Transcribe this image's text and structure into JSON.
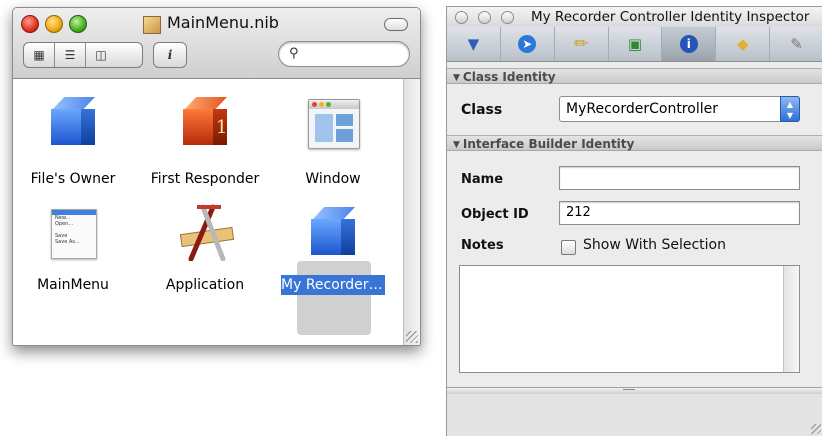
{
  "nib_window": {
    "title": "MainMenu.nib",
    "search_placeholder": "",
    "info_button_label": "i",
    "items": [
      {
        "label": "File's Owner",
        "icon": "blue-cube-icon"
      },
      {
        "label": "First Responder",
        "icon": "red-cube-icon"
      },
      {
        "label": "Window",
        "icon": "window-icon"
      },
      {
        "label": "MainMenu",
        "icon": "menu-icon"
      },
      {
        "label": "Application",
        "icon": "application-icon"
      },
      {
        "label": "My Recorder ...",
        "icon": "blue-cube-icon",
        "selected": true
      }
    ],
    "first_responder_digit": "1",
    "menu_icon_lines": [
      "New...",
      "Open...",
      "",
      "Save",
      "Save As..."
    ]
  },
  "inspector": {
    "title": "My Recorder Controller Identity Inspector",
    "active_tab": "identity",
    "tabs": [
      "attributes-icon",
      "effects-icon",
      "size-ruler-icon",
      "connections-icon",
      "identity-info-icon",
      "bindings-icon",
      "applescript-icon"
    ],
    "class_identity": {
      "header": "Class Identity",
      "class_label": "Class",
      "class_value": "MyRecorderController"
    },
    "ib_identity": {
      "header": "Interface Builder Identity",
      "name_label": "Name",
      "name_value": "",
      "object_id_label": "Object ID",
      "object_id_value": "212",
      "notes_label": "Notes",
      "show_with_selection_label": "Show With Selection",
      "show_with_selection_checked": false,
      "notes_value": ""
    }
  },
  "colors": {
    "selection": "#3875d7",
    "cube_blue": "#2a64d6",
    "cube_red": "#d8461a"
  }
}
